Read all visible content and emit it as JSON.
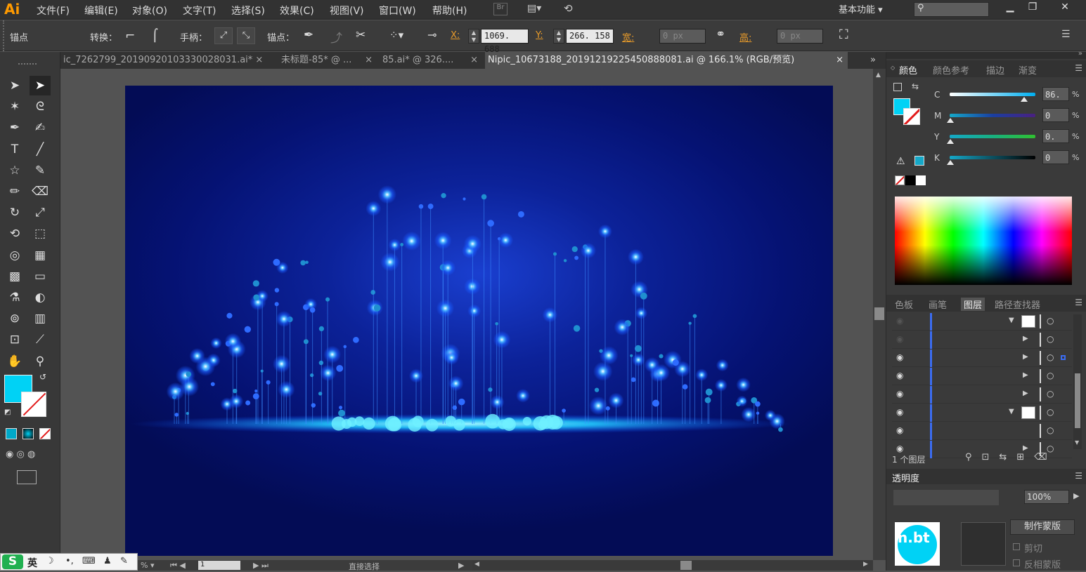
{
  "app": {
    "logo": "Ai"
  },
  "menu": [
    "文件(F)",
    "编辑(E)",
    "对象(O)",
    "文字(T)",
    "选择(S)",
    "效果(C)",
    "视图(V)",
    "窗口(W)",
    "帮助(H)"
  ],
  "header_right": {
    "workspace": "基本功能"
  },
  "control_bar": {
    "context_label": "锚点",
    "convert_label": "转换：",
    "handle_label": "手柄：",
    "anchor_label": "锚点：",
    "x_label": "X:",
    "x_value": "1069. 688",
    "y_label": "Y:",
    "y_value": "266. 158",
    "w_label": "宽:",
    "w_value": "0 px",
    "h_label": "高:",
    "h_value": "0 px"
  },
  "tabs": [
    {
      "label": "ic_7262799_20190920103330028031.ai* ×",
      "active": false
    },
    {
      "label": "未标题-85* @ ...",
      "active": false
    },
    {
      "label": "85.ai* @ 326....",
      "active": false
    },
    {
      "label": "Nipic_10673188_20191219225450888081.ai @ 166.1% (RGB/预览)",
      "active": true
    }
  ],
  "tab_close": "×",
  "color_panel": {
    "tabs": [
      "颜色",
      "颜色参考",
      "描边",
      "渐变"
    ],
    "channels": [
      {
        "label": "C",
        "value": "86. 43",
        "fill": 0.86
      },
      {
        "label": "M",
        "value": "0",
        "fill": 0
      },
      {
        "label": "Y",
        "value": "0. 38",
        "fill": 0.004
      },
      {
        "label": "K",
        "value": "0",
        "fill": 0
      }
    ],
    "percent": "%",
    "fill_color": "#00d2f5"
  },
  "layers_panel": {
    "tabs": [
      "色板",
      "画笔",
      "图层",
      "路径查找器"
    ],
    "footer": "1 个图层"
  },
  "transparency_panel": {
    "tab": "透明度",
    "opacity": "100%",
    "mask_button": "制作蒙版",
    "clip_label": "剪切",
    "invert_label": "反相蒙版",
    "watermark": "n.bt"
  },
  "status": {
    "tool": "直接选择"
  },
  "ime": {
    "label": "英"
  }
}
